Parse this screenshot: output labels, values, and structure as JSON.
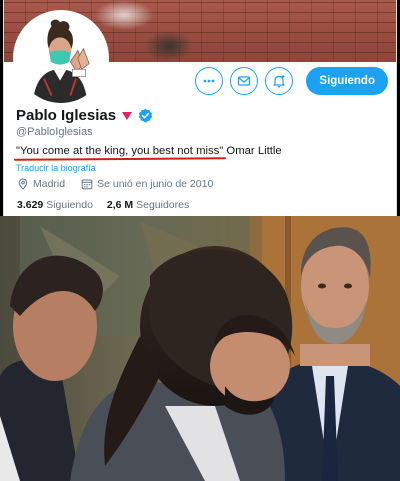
{
  "profile": {
    "name": "Pablo Iglesias",
    "handle": "@PabloIglesias",
    "bio_quote": "\"You come at the king, you best not miss\"",
    "bio_author": " Omar Little",
    "translate_label": "Traducir la biografía",
    "location": "Madrid",
    "joined": "Se unió en junio de 2010",
    "following_count": "3.629",
    "following_label": "Siguiendo",
    "followers_count": "2,6 M",
    "followers_label": "Seguidores"
  },
  "actions": {
    "more_icon": "more-icon",
    "message_icon": "mail-icon",
    "notify_icon": "bell-plus-icon",
    "follow_label": "Siguiendo"
  },
  "colors": {
    "accent": "#1da1f2",
    "verified": "#1da1f2",
    "party_triangle": "#e0245e",
    "underline": "#c8201a"
  },
  "photo": {
    "description_icon": "news-photo"
  }
}
